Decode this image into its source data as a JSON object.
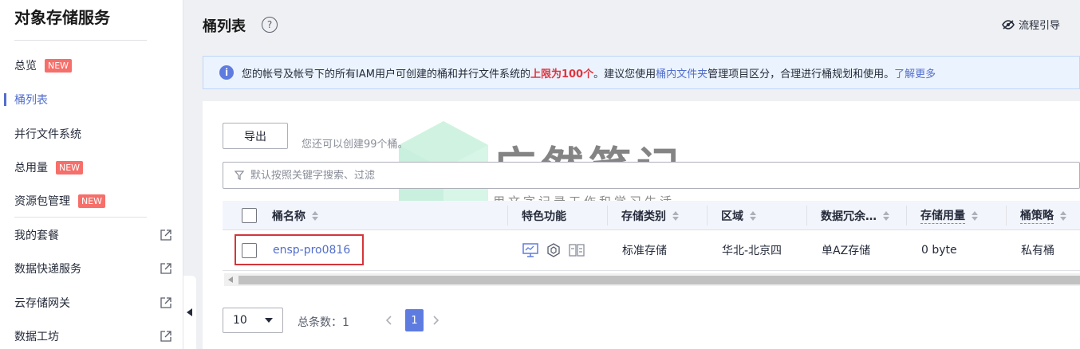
{
  "sidebar": {
    "title": "对象存储服务",
    "items": [
      {
        "label": "总览",
        "badge": "NEW"
      },
      {
        "label": "桶列表",
        "badge": ""
      },
      {
        "label": "并行文件系统",
        "badge": ""
      },
      {
        "label": "总用量",
        "badge": "NEW"
      },
      {
        "label": "资源包管理",
        "badge": "NEW"
      },
      {
        "label": "我的套餐",
        "badge": ""
      },
      {
        "label": "数据快递服务",
        "badge": ""
      },
      {
        "label": "云存储网关",
        "badge": ""
      },
      {
        "label": "数据工坊",
        "badge": ""
      }
    ],
    "active_item": "桶列表"
  },
  "header": {
    "title": "桶列表",
    "help_symbol": "?",
    "guide_label": "流程引导"
  },
  "notice": {
    "icon": "i",
    "text_1": "您的帐号及帐号下的所有IAM用户可创建的桶和并行文件系统的",
    "text_red": "上限为100个",
    "text_2": "。建议您使用",
    "text_link_1": "桶内文件夹",
    "text_3": "管理项目区分，合理进行桶规划和使用。",
    "text_link_2": "了解更多"
  },
  "toolbar": {
    "export_label": "导出",
    "quota_text": "您还可以创建99个桶。",
    "search_placeholder": "默认按照关键字搜索、过滤"
  },
  "table": {
    "columns": [
      "桶名称",
      "特色功能",
      "存储类别",
      "区域",
      "数据冗余…",
      "存储用量",
      "桶策略"
    ],
    "rows": [
      {
        "name": "ensp-pro0816",
        "storage_class": "标准存储",
        "region": "华北-北京四",
        "redundancy": "单AZ存储",
        "usage": "0 byte",
        "policy": "私有桶"
      }
    ]
  },
  "pagination": {
    "page_size": "10",
    "total_label": "总条数：1",
    "current_page": "1"
  },
  "watermark": {
    "main": "广然笔记",
    "sub": "用文字记录工作和学习生活"
  },
  "colors": {
    "accent": "#526ecc",
    "badge": "#f66f6a",
    "highlight": "#d4353b",
    "page_active": "#5e7ce0"
  }
}
